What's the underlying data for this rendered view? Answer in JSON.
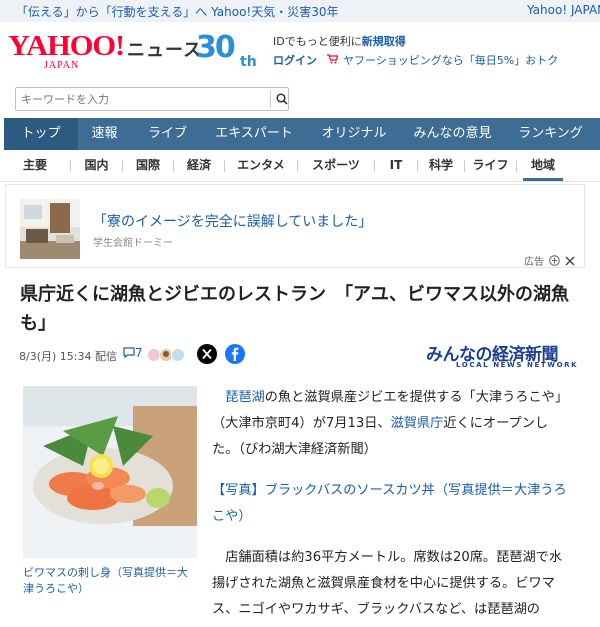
{
  "topbar": {
    "left_text": "「伝える」から「行動を支える」へ Yahoo!天気・災害30年",
    "right_text": "Yahoo! JAPAN"
  },
  "header": {
    "logo_main": "YAHOO!",
    "logo_sub": "JAPAN",
    "news_label": "ニュース",
    "anniv_number": "30",
    "anniv_suffix": "th",
    "promo_line1_prefix": "IDでもっと便利に",
    "promo_line1_link": "新規取得",
    "promo_login": "ログイン",
    "promo_shopping": "ヤフーショッピングなら「毎日5%」おトク"
  },
  "search": {
    "placeholder": "キーワードを入力"
  },
  "main_nav": [
    {
      "label": "トップ",
      "active": true
    },
    {
      "label": "速報"
    },
    {
      "label": "ライブ"
    },
    {
      "label": "エキスパート"
    },
    {
      "label": "オリジナル"
    },
    {
      "label": "みんなの意見"
    },
    {
      "label": "ランキング"
    }
  ],
  "sub_nav": [
    {
      "label": "主要"
    },
    {
      "label": "国内"
    },
    {
      "label": "国際"
    },
    {
      "label": "経済"
    },
    {
      "label": "エンタメ"
    },
    {
      "label": "スポーツ"
    },
    {
      "label": "IT"
    },
    {
      "label": "科学"
    },
    {
      "label": "ライフ"
    },
    {
      "label": "地域",
      "active": true
    }
  ],
  "ad": {
    "title": "「寮のイメージを完全に誤解していました」",
    "sponsor": "学生会館ドーミー",
    "label": "広告"
  },
  "article": {
    "title": "県庁近くに湖魚とジビエのレストラン　「アユ、ビワマス以外の湖魚も」",
    "date": "8/3(月) 15:34 配信",
    "comment_count": "7",
    "source_jp": "みんなの経済新聞",
    "source_en": "LOCAL NEWS NETWORK",
    "photo_caption": "ビワマスの刺し身（写真提供＝大津うろこや）",
    "p1_link1": "琵琶湖",
    "p1_text1": "の魚と滋賀県産ジビエを提供する「大津うろこや」（大津市京町4）が7月13日、",
    "p1_link2": "滋賀県庁",
    "p1_text2": "近くにオープンした。（びわ湖大津経済新聞）",
    "photo_link": "【写真】ブラックバスのソースカツ丼（写真提供＝大津うろこや）",
    "p2_text": "店舗面積は約36平方メートル。席数は20席。琵琶湖で水揚げされた湖魚と滋賀県産食材を中心に提供する。ビワマス、ニゴイやワカサギ、ブラックバスなど、は琵琶湖の"
  },
  "colors": {
    "nav_blue": "#3d6d95",
    "link_blue": "#1a5ea8",
    "yahoo_red": "#ff0033"
  }
}
